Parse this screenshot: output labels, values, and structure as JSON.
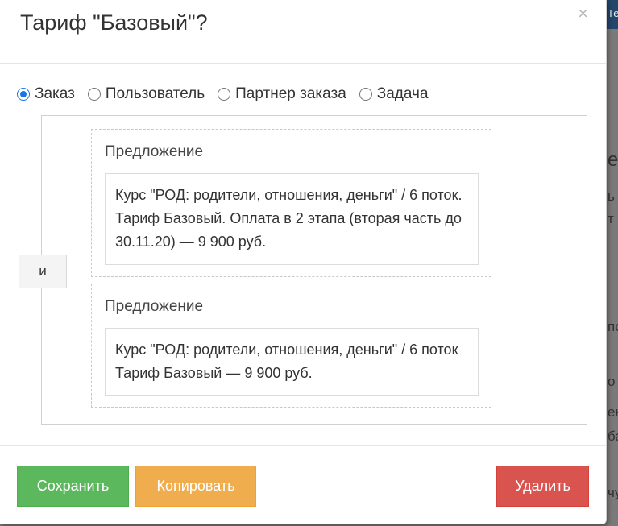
{
  "modal": {
    "title": "Тариф \"Базовый\"?",
    "close_symbol": "×"
  },
  "radios": [
    {
      "label": "Заказ",
      "checked": true
    },
    {
      "label": "Пользователь",
      "checked": false
    },
    {
      "label": "Партнер заказа",
      "checked": false
    },
    {
      "label": "Задача",
      "checked": false
    }
  ],
  "logic_operator": "и",
  "conditions": [
    {
      "label": "Предложение",
      "value": "Курс \"РОД: родители, отношения, деньги\" / 6 поток. Тариф Базовый. Оплата в 2 этапа (вторая часть до 30.11.20) — 9 900 руб."
    },
    {
      "label": "Предложение",
      "value": "Курс \"РОД: родители, отношения, деньги\" / 6 поток Тариф Базовый — 9 900 руб."
    }
  ],
  "footer": {
    "save_label": "Сохранить",
    "copy_label": "Копировать",
    "delete_label": "Удалить"
  },
  "background_fragments": [
    "Те",
    "е",
    "ь",
    "т",
    "по",
    "о",
    "ен",
    "ба",
    "чу"
  ],
  "colors": {
    "save": "#5cb85c",
    "copy": "#f0ad4e",
    "delete": "#d9534f",
    "radio_accent": "#1a73e8"
  }
}
